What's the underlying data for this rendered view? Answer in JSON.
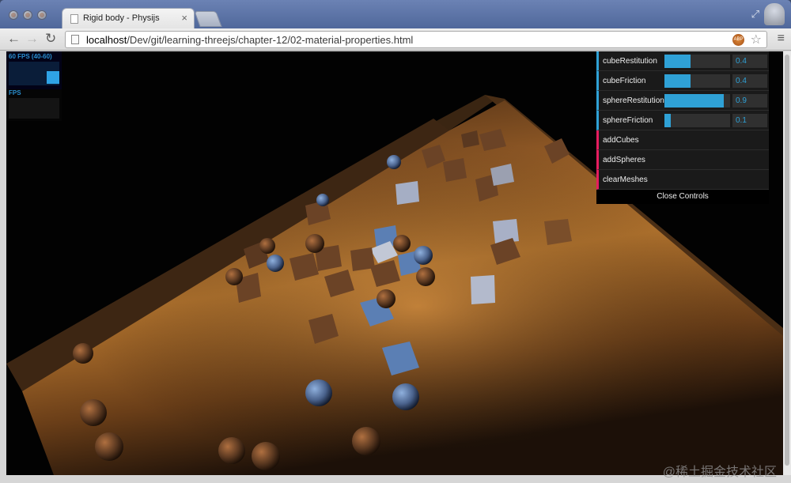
{
  "window": {
    "tab_title": "Rigid body - Physijs",
    "tab_close": "×",
    "fullscreen_glyph": "⤢"
  },
  "toolbar": {
    "back_glyph": "←",
    "forward_glyph": "→",
    "reload_glyph": "↻",
    "url_host": "localhost",
    "url_path": "/Dev/git/learning-threejs/chapter-12/02-material-properties.html",
    "ext_badge": "ABP",
    "star_glyph": "☆",
    "menu_glyph": "≡"
  },
  "stats": {
    "fps_text": "60 FPS (40-60)",
    "ms_text": "FPS"
  },
  "gui": {
    "controls": [
      {
        "label": "cubeRestitution",
        "value": "0.4",
        "fraction": 0.4
      },
      {
        "label": "cubeFriction",
        "value": "0.4",
        "fraction": 0.4
      },
      {
        "label": "sphereRestitution",
        "value": "0.9",
        "fraction": 0.9
      },
      {
        "label": "sphereFriction",
        "value": "0.1",
        "fraction": 0.1
      }
    ],
    "functions": [
      "addCubes",
      "addSpheres",
      "clearMeshes"
    ],
    "close_label": "Close Controls"
  },
  "colors": {
    "gui_accent": "#2fa1d6",
    "floor": "#a0642a",
    "cube": "#6b4326",
    "cube_blue": "#5b7fb4",
    "sphere": "#5a3820"
  },
  "watermark": "@稀土掘金技术社区"
}
